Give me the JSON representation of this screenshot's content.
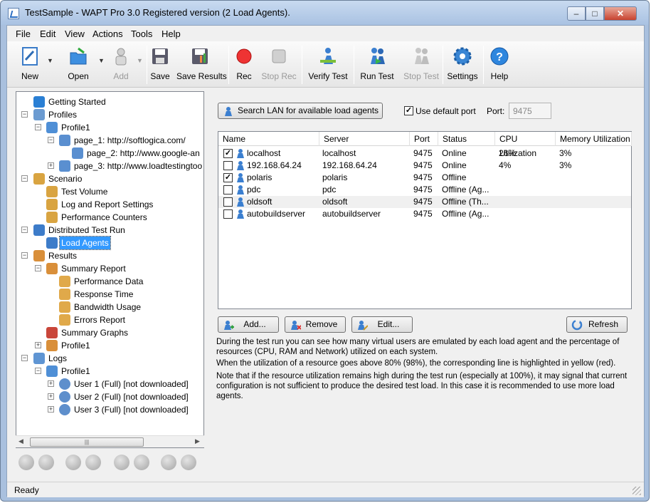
{
  "window": {
    "title": "TestSample - WAPT Pro 3.0 Registered version (2 Load Agents)."
  },
  "menu": [
    "File",
    "Edit",
    "View",
    "Actions",
    "Tools",
    "Help"
  ],
  "toolbar": {
    "new": "New",
    "open": "Open",
    "add": "Add",
    "save": "Save",
    "save_results": "Save Results",
    "rec": "Rec",
    "stop_rec": "Stop Rec",
    "verify_test": "Verify Test",
    "run_test": "Run Test",
    "stop_test": "Stop Test",
    "settings": "Settings",
    "help": "Help"
  },
  "tree": {
    "getting_started": "Getting Started",
    "profiles": "Profiles",
    "profile1": "Profile1",
    "page1": "page_1: http://softlogica.com/",
    "page2": "page_2: http://www.google-an",
    "page3": "page_3: http://www.loadtestingtoo",
    "scenario": "Scenario",
    "test_volume": "Test Volume",
    "log_report": "Log and Report Settings",
    "perf_counters": "Performance Counters",
    "distributed": "Distributed Test Run",
    "load_agents": "Load Agents",
    "results": "Results",
    "summary_report": "Summary Report",
    "perf_data": "Performance Data",
    "response_time": "Response Time",
    "bandwidth": "Bandwidth Usage",
    "errors_report": "Errors Report",
    "summary_graphs": "Summary Graphs",
    "results_profile1": "Profile1",
    "logs": "Logs",
    "logs_profile1": "Profile1",
    "user1": "User 1 (Full) [not downloaded]",
    "user2": "User 2 (Full) [not downloaded]",
    "user3": "User 3 (Full) [not downloaded]"
  },
  "agents": {
    "search_button": "Search LAN for available load agents",
    "use_default_port": "Use default port",
    "port_label": "Port:",
    "port_value": "9475",
    "columns": [
      "Name",
      "Server",
      "Port",
      "Status",
      "CPU Utilization",
      "Memory Utilization"
    ],
    "rows": [
      {
        "checked": true,
        "name": "localhost",
        "server": "localhost",
        "port": "9475",
        "status": "Online",
        "cpu": "26%",
        "mem": "3%"
      },
      {
        "checked": false,
        "name": "192.168.64.24",
        "server": "192.168.64.24",
        "port": "9475",
        "status": "Online",
        "cpu": "4%",
        "mem": "3%"
      },
      {
        "checked": true,
        "name": "polaris",
        "server": "polaris",
        "port": "9475",
        "status": "Offline",
        "cpu": "",
        "mem": ""
      },
      {
        "checked": false,
        "name": "pdc",
        "server": "pdc",
        "port": "9475",
        "status": "Offline (Ag...",
        "cpu": "",
        "mem": ""
      },
      {
        "checked": false,
        "name": "oldsoft",
        "server": "oldsoft",
        "port": "9475",
        "status": "Offline (Th...",
        "cpu": "",
        "mem": ""
      },
      {
        "checked": false,
        "name": "autobuildserver",
        "server": "autobuildserver",
        "port": "9475",
        "status": "Offline (Ag...",
        "cpu": "",
        "mem": ""
      }
    ],
    "add_button": "Add...",
    "remove_button": "Remove",
    "edit_button": "Edit...",
    "refresh_button": "Refresh",
    "desc1a": "During the test run you can see how many virtual users are emulated by each load agent and the percentage of",
    "desc1b": "resources (CPU, RAM and Network) utilized on each system.",
    "desc2": "When the utilization of a resource goes above 80% (98%), the corresponding line is highlighted in yellow (red).",
    "desc3a": "Note that if the resource utilization remains high during the test run (especially at 100%), it may signal that current",
    "desc3b": "configuration is not sufficient to produce the desired test load. In this case it is recommended to use more load agents."
  },
  "status": {
    "text": "Ready"
  }
}
